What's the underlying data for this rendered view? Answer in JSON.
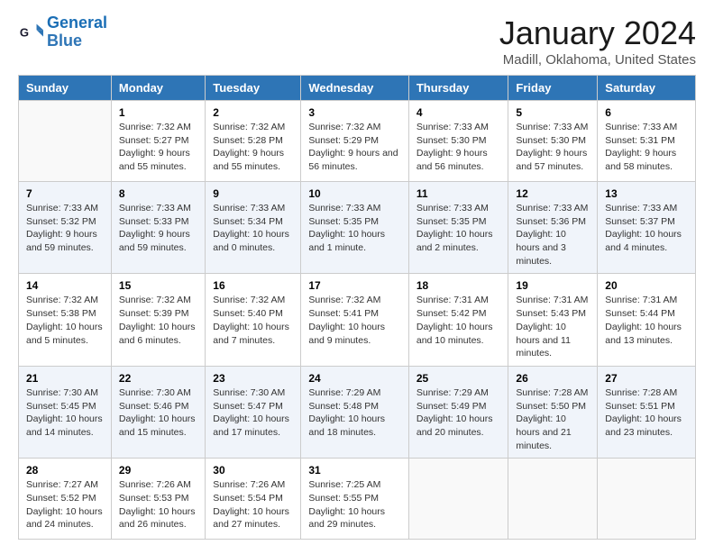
{
  "header": {
    "logo_line1": "General",
    "logo_line2": "Blue",
    "month_title": "January 2024",
    "location": "Madill, Oklahoma, United States"
  },
  "weekdays": [
    "Sunday",
    "Monday",
    "Tuesday",
    "Wednesday",
    "Thursday",
    "Friday",
    "Saturday"
  ],
  "weeks": [
    [
      {
        "day": "",
        "sunrise": "",
        "sunset": "",
        "daylight": ""
      },
      {
        "day": "1",
        "sunrise": "Sunrise: 7:32 AM",
        "sunset": "Sunset: 5:27 PM",
        "daylight": "Daylight: 9 hours and 55 minutes."
      },
      {
        "day": "2",
        "sunrise": "Sunrise: 7:32 AM",
        "sunset": "Sunset: 5:28 PM",
        "daylight": "Daylight: 9 hours and 55 minutes."
      },
      {
        "day": "3",
        "sunrise": "Sunrise: 7:32 AM",
        "sunset": "Sunset: 5:29 PM",
        "daylight": "Daylight: 9 hours and 56 minutes."
      },
      {
        "day": "4",
        "sunrise": "Sunrise: 7:33 AM",
        "sunset": "Sunset: 5:30 PM",
        "daylight": "Daylight: 9 hours and 56 minutes."
      },
      {
        "day": "5",
        "sunrise": "Sunrise: 7:33 AM",
        "sunset": "Sunset: 5:30 PM",
        "daylight": "Daylight: 9 hours and 57 minutes."
      },
      {
        "day": "6",
        "sunrise": "Sunrise: 7:33 AM",
        "sunset": "Sunset: 5:31 PM",
        "daylight": "Daylight: 9 hours and 58 minutes."
      }
    ],
    [
      {
        "day": "7",
        "sunrise": "Sunrise: 7:33 AM",
        "sunset": "Sunset: 5:32 PM",
        "daylight": "Daylight: 9 hours and 59 minutes."
      },
      {
        "day": "8",
        "sunrise": "Sunrise: 7:33 AM",
        "sunset": "Sunset: 5:33 PM",
        "daylight": "Daylight: 9 hours and 59 minutes."
      },
      {
        "day": "9",
        "sunrise": "Sunrise: 7:33 AM",
        "sunset": "Sunset: 5:34 PM",
        "daylight": "Daylight: 10 hours and 0 minutes."
      },
      {
        "day": "10",
        "sunrise": "Sunrise: 7:33 AM",
        "sunset": "Sunset: 5:35 PM",
        "daylight": "Daylight: 10 hours and 1 minute."
      },
      {
        "day": "11",
        "sunrise": "Sunrise: 7:33 AM",
        "sunset": "Sunset: 5:35 PM",
        "daylight": "Daylight: 10 hours and 2 minutes."
      },
      {
        "day": "12",
        "sunrise": "Sunrise: 7:33 AM",
        "sunset": "Sunset: 5:36 PM",
        "daylight": "Daylight: 10 hours and 3 minutes."
      },
      {
        "day": "13",
        "sunrise": "Sunrise: 7:33 AM",
        "sunset": "Sunset: 5:37 PM",
        "daylight": "Daylight: 10 hours and 4 minutes."
      }
    ],
    [
      {
        "day": "14",
        "sunrise": "Sunrise: 7:32 AM",
        "sunset": "Sunset: 5:38 PM",
        "daylight": "Daylight: 10 hours and 5 minutes."
      },
      {
        "day": "15",
        "sunrise": "Sunrise: 7:32 AM",
        "sunset": "Sunset: 5:39 PM",
        "daylight": "Daylight: 10 hours and 6 minutes."
      },
      {
        "day": "16",
        "sunrise": "Sunrise: 7:32 AM",
        "sunset": "Sunset: 5:40 PM",
        "daylight": "Daylight: 10 hours and 7 minutes."
      },
      {
        "day": "17",
        "sunrise": "Sunrise: 7:32 AM",
        "sunset": "Sunset: 5:41 PM",
        "daylight": "Daylight: 10 hours and 9 minutes."
      },
      {
        "day": "18",
        "sunrise": "Sunrise: 7:31 AM",
        "sunset": "Sunset: 5:42 PM",
        "daylight": "Daylight: 10 hours and 10 minutes."
      },
      {
        "day": "19",
        "sunrise": "Sunrise: 7:31 AM",
        "sunset": "Sunset: 5:43 PM",
        "daylight": "Daylight: 10 hours and 11 minutes."
      },
      {
        "day": "20",
        "sunrise": "Sunrise: 7:31 AM",
        "sunset": "Sunset: 5:44 PM",
        "daylight": "Daylight: 10 hours and 13 minutes."
      }
    ],
    [
      {
        "day": "21",
        "sunrise": "Sunrise: 7:30 AM",
        "sunset": "Sunset: 5:45 PM",
        "daylight": "Daylight: 10 hours and 14 minutes."
      },
      {
        "day": "22",
        "sunrise": "Sunrise: 7:30 AM",
        "sunset": "Sunset: 5:46 PM",
        "daylight": "Daylight: 10 hours and 15 minutes."
      },
      {
        "day": "23",
        "sunrise": "Sunrise: 7:30 AM",
        "sunset": "Sunset: 5:47 PM",
        "daylight": "Daylight: 10 hours and 17 minutes."
      },
      {
        "day": "24",
        "sunrise": "Sunrise: 7:29 AM",
        "sunset": "Sunset: 5:48 PM",
        "daylight": "Daylight: 10 hours and 18 minutes."
      },
      {
        "day": "25",
        "sunrise": "Sunrise: 7:29 AM",
        "sunset": "Sunset: 5:49 PM",
        "daylight": "Daylight: 10 hours and 20 minutes."
      },
      {
        "day": "26",
        "sunrise": "Sunrise: 7:28 AM",
        "sunset": "Sunset: 5:50 PM",
        "daylight": "Daylight: 10 hours and 21 minutes."
      },
      {
        "day": "27",
        "sunrise": "Sunrise: 7:28 AM",
        "sunset": "Sunset: 5:51 PM",
        "daylight": "Daylight: 10 hours and 23 minutes."
      }
    ],
    [
      {
        "day": "28",
        "sunrise": "Sunrise: 7:27 AM",
        "sunset": "Sunset: 5:52 PM",
        "daylight": "Daylight: 10 hours and 24 minutes."
      },
      {
        "day": "29",
        "sunrise": "Sunrise: 7:26 AM",
        "sunset": "Sunset: 5:53 PM",
        "daylight": "Daylight: 10 hours and 26 minutes."
      },
      {
        "day": "30",
        "sunrise": "Sunrise: 7:26 AM",
        "sunset": "Sunset: 5:54 PM",
        "daylight": "Daylight: 10 hours and 27 minutes."
      },
      {
        "day": "31",
        "sunrise": "Sunrise: 7:25 AM",
        "sunset": "Sunset: 5:55 PM",
        "daylight": "Daylight: 10 hours and 29 minutes."
      },
      {
        "day": "",
        "sunrise": "",
        "sunset": "",
        "daylight": ""
      },
      {
        "day": "",
        "sunrise": "",
        "sunset": "",
        "daylight": ""
      },
      {
        "day": "",
        "sunrise": "",
        "sunset": "",
        "daylight": ""
      }
    ]
  ]
}
